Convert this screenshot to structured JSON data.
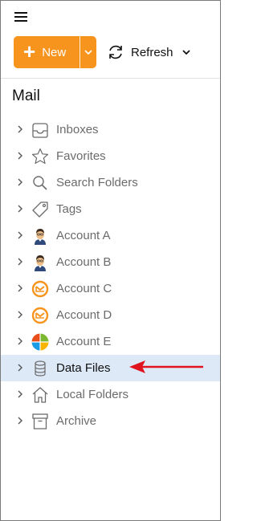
{
  "toolbar": {
    "new_label": "New",
    "refresh_label": "Refresh"
  },
  "nav": {
    "section_title": "Mail",
    "items": [
      {
        "label": "Inboxes",
        "icon": "inbox-tray-icon"
      },
      {
        "label": "Favorites",
        "icon": "star-icon"
      },
      {
        "label": "Search Folders",
        "icon": "search-icon"
      },
      {
        "label": "Tags",
        "icon": "tag-icon"
      },
      {
        "label": "Account A",
        "icon": "user-avatar-icon"
      },
      {
        "label": "Account B",
        "icon": "user-avatar-icon"
      },
      {
        "label": "Account C",
        "icon": "emclient-logo-icon"
      },
      {
        "label": "Account D",
        "icon": "emclient-logo-icon"
      },
      {
        "label": "Account E",
        "icon": "microsoft-logo-icon"
      },
      {
        "label": "Data Files",
        "icon": "database-icon",
        "selected": true
      },
      {
        "label": "Local Folders",
        "icon": "house-icon"
      },
      {
        "label": "Archive",
        "icon": "archive-box-icon"
      }
    ]
  },
  "colors": {
    "accent": "#f7941d",
    "selection": "#dde9f7",
    "annotation_arrow": "#e0141e"
  }
}
